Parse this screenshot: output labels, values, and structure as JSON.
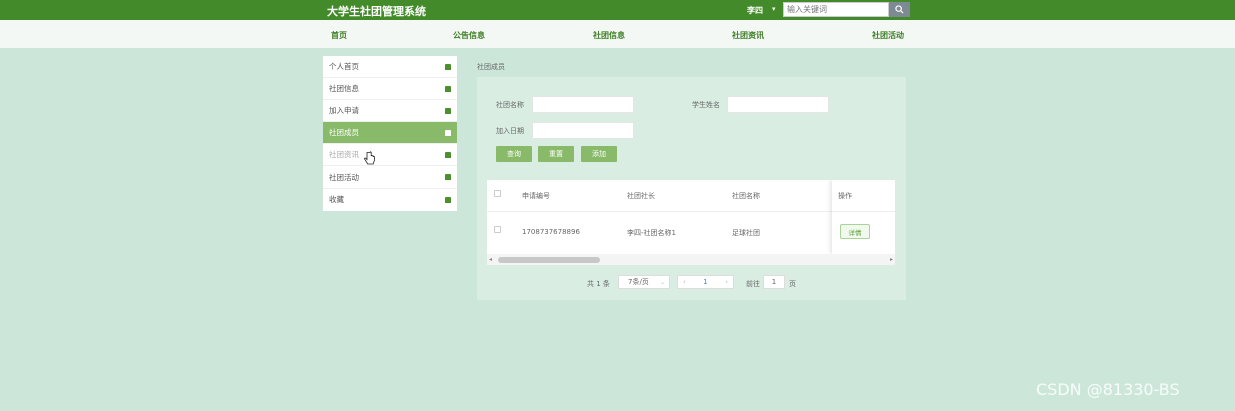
{
  "header": {
    "title": "大学生社团管理系统",
    "user": "李四",
    "search_placeholder": "输入关键词",
    "accent": "#438a2a"
  },
  "nav": {
    "items": [
      "首页",
      "公告信息",
      "社团信息",
      "社团资讯",
      "社团活动"
    ]
  },
  "sidebar": {
    "items": [
      {
        "label": "个人首页"
      },
      {
        "label": "社团信息"
      },
      {
        "label": "加入申请"
      },
      {
        "label": "社团成员"
      },
      {
        "label": "社团资讯"
      },
      {
        "label": "社团活动"
      },
      {
        "label": "收藏"
      }
    ],
    "active_index": 3
  },
  "breadcrumb": "社团成员",
  "filters": {
    "club_name_label": "社团名称",
    "student_name_label": "学生姓名",
    "join_date_label": "加入日期",
    "buttons": {
      "query": "查询",
      "reset": "重置",
      "add": "添加"
    }
  },
  "table": {
    "columns": [
      "申请编号",
      "社团社长",
      "社团名称",
      "操作"
    ],
    "rows": [
      {
        "id": "1708737678896",
        "leader": "李四-社团名称1",
        "club": "足球社团",
        "action": "详情"
      }
    ]
  },
  "pagination": {
    "total_text": "共 1 条",
    "page_size": "7条/页",
    "current_page": "1",
    "goto_label": "前往",
    "goto_value": "1",
    "page_suffix": "页"
  },
  "watermark": "CSDN @81330-BS"
}
